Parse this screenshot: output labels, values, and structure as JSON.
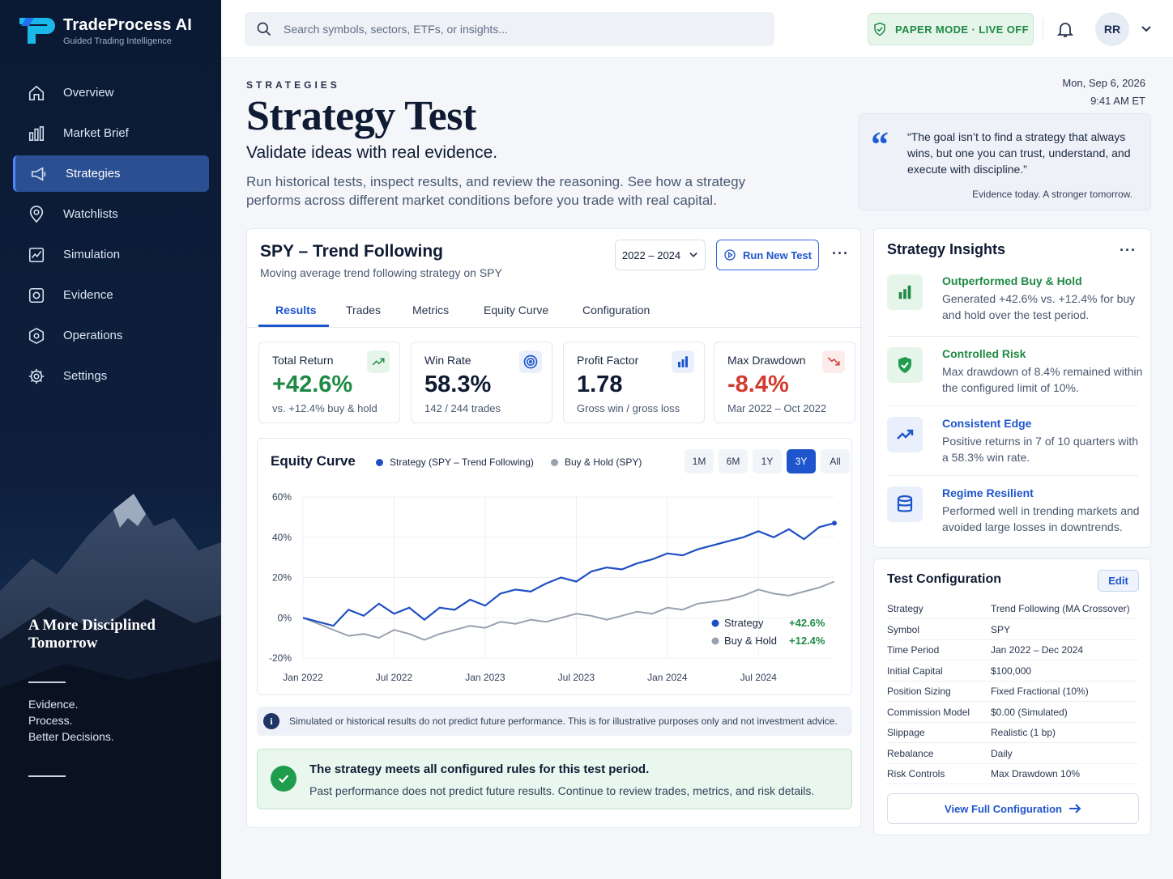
{
  "app": {
    "name": "TradeProcess AI",
    "tagline": "Guided Trading Intelligence"
  },
  "nav": [
    {
      "label": "Overview",
      "icon": "home-icon",
      "active": false
    },
    {
      "label": "Market Brief",
      "icon": "bar-chart-icon",
      "active": false
    },
    {
      "label": "Strategies",
      "icon": "megaphone-icon",
      "active": true
    },
    {
      "label": "Watchlists",
      "icon": "location-pin-icon",
      "active": false
    },
    {
      "label": "Simulation",
      "icon": "line-chart-icon",
      "active": false
    },
    {
      "label": "Evidence",
      "icon": "evidence-icon",
      "active": false
    },
    {
      "label": "Operations",
      "icon": "hexagon-icon",
      "active": false
    },
    {
      "label": "Settings",
      "icon": "gear-icon",
      "active": false
    }
  ],
  "sidebar": {
    "tagline": "A More Disciplined Tomorrow",
    "motto": [
      "Evidence.",
      "Process.",
      "Better Decisions."
    ]
  },
  "topbar": {
    "search_placeholder": "Search symbols, sectors, ETFs, or insights...",
    "mode_badge": "PAPER MODE · LIVE OFF",
    "avatar_initials": "RR"
  },
  "page": {
    "eyebrow": "STRATEGIES",
    "title": "Strategy Test",
    "subtitle": "Validate ideas with real evidence.",
    "description": "Run historical tests, inspect results, and review the reasoning. See how a strategy performs across different market conditions before you trade with real capital.",
    "date": "Mon, Sep 6, 2026",
    "time": "9:41 AM ET"
  },
  "quote": {
    "text": "“The goal isn’t to find a strategy that always wins, but one you can trust, understand, and execute with discipline.”",
    "footer": "Evidence today. A stronger tomorrow."
  },
  "strategy": {
    "title": "SPY – Trend Following",
    "subtitle": "Moving average trend following strategy on SPY",
    "range": "2022 – 2024",
    "run_label": "Run New Test",
    "tabs": [
      "Results",
      "Trades",
      "Metrics",
      "Equity Curve",
      "Configuration"
    ],
    "active_tab": "Results"
  },
  "metrics": [
    {
      "label": "Total Return",
      "value": "+42.6%",
      "sub": "vs. +12.4% buy & hold",
      "color": "#1f8a45",
      "icon": "trend-up-icon"
    },
    {
      "label": "Win Rate",
      "value": "58.3%",
      "sub": "142 / 244 trades",
      "color": "#0f1b33",
      "icon": "target-icon"
    },
    {
      "label": "Profit Factor",
      "value": "1.78",
      "sub": "Gross win / gross loss",
      "color": "#0f1b33",
      "icon": "bar-chart-icon"
    },
    {
      "label": "Max Drawdown",
      "value": "-8.4%",
      "sub": "Mar 2022 – Oct 2022",
      "color": "#d23b2e",
      "icon": "drawdown-icon"
    }
  ],
  "chart_data": {
    "type": "line",
    "title": "Equity Curve",
    "x_ticks": [
      "Jan 2022",
      "Jul 2022",
      "Jan 2023",
      "Jul 2023",
      "Jan 2024",
      "Jul 2024"
    ],
    "y_ticks": [
      "60%",
      "40%",
      "20%",
      "0%",
      "-20%"
    ],
    "ylim": [
      -20,
      60
    ],
    "range_buttons": [
      "1M",
      "6M",
      "1Y",
      "3Y",
      "All"
    ],
    "active_range": "3Y",
    "series": [
      {
        "name": "Strategy (SPY – Trend Following)",
        "short_name": "Strategy",
        "color": "#1f4fc4",
        "final": "+42.6%",
        "x": [
          0,
          1,
          2,
          3,
          4,
          5,
          6,
          7,
          8,
          9,
          10,
          11,
          12,
          13,
          14,
          15,
          16,
          17,
          18,
          19,
          20,
          21,
          22,
          23,
          24,
          25,
          26,
          27,
          28,
          29,
          30,
          31,
          32,
          33,
          34,
          35
        ],
        "values": [
          0,
          -2,
          -4,
          4,
          1,
          7,
          2,
          5,
          -1,
          5,
          4,
          9,
          6,
          12,
          14,
          13,
          17,
          20,
          18,
          23,
          25,
          24,
          27,
          29,
          32,
          31,
          34,
          36,
          38,
          40,
          43,
          40,
          44,
          39,
          45,
          47
        ]
      },
      {
        "name": "Buy & Hold (SPY)",
        "short_name": "Buy & Hold",
        "color": "#9aa2b0",
        "final": "+12.4%",
        "x": [
          0,
          1,
          2,
          3,
          4,
          5,
          6,
          7,
          8,
          9,
          10,
          11,
          12,
          13,
          14,
          15,
          16,
          17,
          18,
          19,
          20,
          21,
          22,
          23,
          24,
          25,
          26,
          27,
          28,
          29,
          30,
          31,
          32,
          33,
          34,
          35
        ],
        "values": [
          0,
          -3,
          -6,
          -9,
          -8,
          -10,
          -6,
          -8,
          -11,
          -8,
          -6,
          -4,
          -5,
          -2,
          -3,
          -1,
          -2,
          0,
          2,
          1,
          -1,
          1,
          3,
          2,
          5,
          4,
          7,
          8,
          9,
          11,
          14,
          12,
          11,
          13,
          15,
          18
        ]
      }
    ]
  },
  "disclaimer": "Simulated or historical results do not predict future performance. This is for illustrative purposes only and not investment advice.",
  "success": {
    "title": "The strategy meets all configured rules for this test period.",
    "text": "Past performance does not predict future results. Continue to review trades, metrics, and risk details."
  },
  "insights": {
    "title": "Strategy Insights",
    "items": [
      {
        "title": "Outperformed Buy & Hold",
        "body": "Generated +42.6% vs. +12.4% for buy and hold over the test period.",
        "color": "#1f8a45",
        "icon": "bar-chart-icon"
      },
      {
        "title": "Controlled Risk",
        "body": "Max drawdown of 8.4% remained within the configured limit of 10%.",
        "color": "#1f8a45",
        "icon": "shield-check-icon"
      },
      {
        "title": "Consistent Edge",
        "body": "Positive returns in 7 of 10 quarters with a 58.3% win rate.",
        "color": "#1f55cc",
        "icon": "trend-up-icon"
      },
      {
        "title": "Regime Resilient",
        "body": "Performed well in trending markets and avoided large losses in downtrends.",
        "color": "#1f55cc",
        "icon": "database-icon"
      }
    ]
  },
  "config": {
    "title": "Test Configuration",
    "edit_label": "Edit",
    "rows": [
      {
        "key": "Strategy",
        "value": "Trend Following (MA Crossover)"
      },
      {
        "key": "Symbol",
        "value": "SPY"
      },
      {
        "key": "Time Period",
        "value": "Jan 2022 – Dec 2024"
      },
      {
        "key": "Initial Capital",
        "value": "$100,000"
      },
      {
        "key": "Position Sizing",
        "value": "Fixed Fractional (10%)"
      },
      {
        "key": "Commission Model",
        "value": "$0.00 (Simulated)"
      },
      {
        "key": "Slippage",
        "value": "Realistic (1 bp)"
      },
      {
        "key": "Rebalance",
        "value": "Daily"
      },
      {
        "key": "Risk Controls",
        "value": "Max Drawdown 10%"
      }
    ],
    "view_label": "View Full Configuration"
  }
}
